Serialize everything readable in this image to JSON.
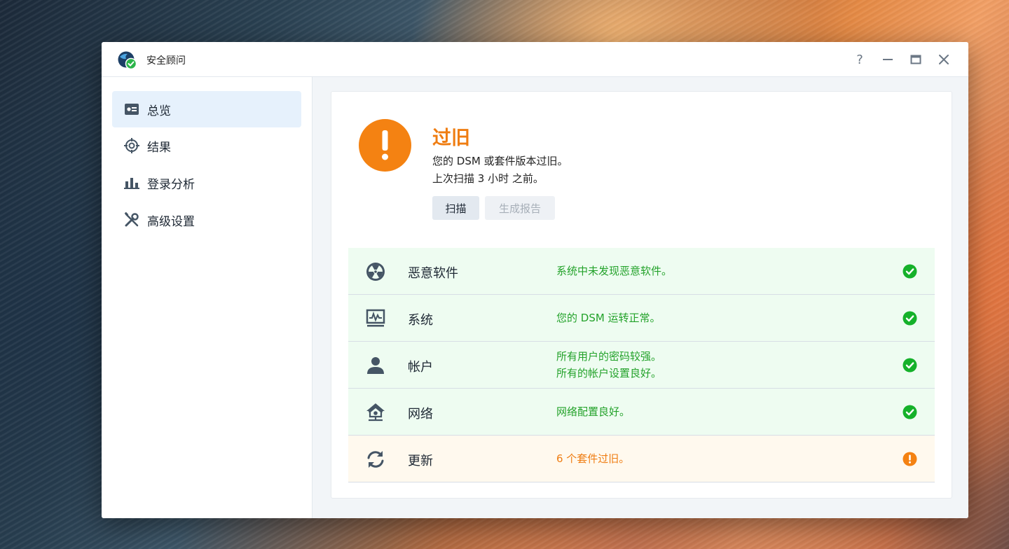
{
  "window": {
    "title": "安全顾问",
    "help_label": "?"
  },
  "sidebar": {
    "items": [
      {
        "label": "总览",
        "icon": "overview-card-icon",
        "active": true
      },
      {
        "label": "结果",
        "icon": "target-icon",
        "active": false
      },
      {
        "label": "登录分析",
        "icon": "bar-chart-icon",
        "active": false
      },
      {
        "label": "高级设置",
        "icon": "tools-icon",
        "active": false
      }
    ]
  },
  "status": {
    "title": "过旧",
    "line1": "您的 DSM 或套件版本过旧。",
    "line2": "上次扫描 3 小时 之前。",
    "icon": "exclamation-icon",
    "color": "#f48212"
  },
  "buttons": {
    "scan": "扫描",
    "report": "生成报告"
  },
  "checks": [
    {
      "name": "恶意软件",
      "icon": "radiation-icon",
      "messages": [
        "系统中未发现恶意软件。"
      ],
      "state": "ok"
    },
    {
      "name": "系统",
      "icon": "system-monitor-icon",
      "messages": [
        "您的 DSM 运转正常。"
      ],
      "state": "ok"
    },
    {
      "name": "帐户",
      "icon": "user-icon",
      "messages": [
        "所有用户的密码较强。",
        "所有的帐户设置良好。"
      ],
      "state": "ok"
    },
    {
      "name": "网络",
      "icon": "home-network-icon",
      "messages": [
        "网络配置良好。"
      ],
      "state": "ok"
    },
    {
      "name": "更新",
      "icon": "refresh-icon",
      "messages": [
        "6 个套件过旧。"
      ],
      "state": "warn"
    }
  ],
  "colors": {
    "ok": "#15b12a",
    "warn": "#f48212",
    "accent_active_bg": "#e6f1fc"
  }
}
